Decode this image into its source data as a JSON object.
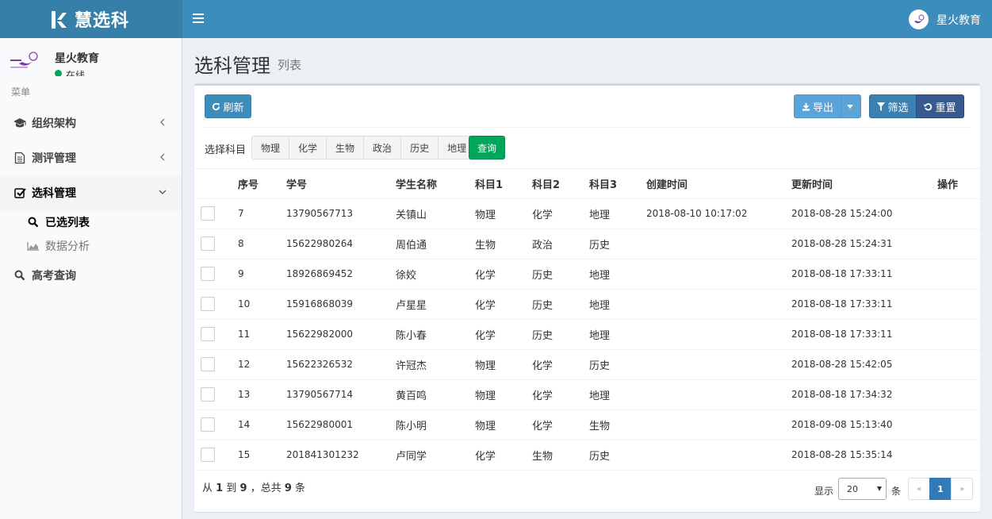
{
  "header": {
    "app_name": "慧选科",
    "user_name": "星火教育"
  },
  "sidebar": {
    "user": {
      "name": "星火教育",
      "status": "在线"
    },
    "menu_header": "菜单",
    "items": [
      {
        "label": "组织架构",
        "icon": "graduation-cap-icon"
      },
      {
        "label": "测评管理",
        "icon": "file-text-icon"
      },
      {
        "label": "选科管理",
        "icon": "check-square-icon"
      },
      {
        "label": "高考查询",
        "icon": "search-icon"
      }
    ],
    "sub_items": [
      {
        "label": "已选列表",
        "icon": "search-icon"
      },
      {
        "label": "数据分析",
        "icon": "area-chart-icon"
      }
    ]
  },
  "page": {
    "title": "选科管理",
    "subtitle": "列表"
  },
  "toolbar": {
    "refresh_label": "刷新",
    "export_label": "导出",
    "filter_label": "筛选",
    "reset_label": "重置"
  },
  "subject_filter": {
    "label": "选择科目",
    "subjects": [
      "物理",
      "化学",
      "生物",
      "政治",
      "历史",
      "地理"
    ],
    "query_label": "查询"
  },
  "table": {
    "columns": [
      "序号",
      "学号",
      "学生名称",
      "科目1",
      "科目2",
      "科目3",
      "创建时间",
      "更新时间",
      "操作"
    ],
    "rows": [
      {
        "seq": "7",
        "student_id": "13790567713",
        "name": "关镇山",
        "s1": "物理",
        "s2": "化学",
        "s3": "地理",
        "created": "2018-08-10 10:17:02",
        "updated": "2018-08-28 15:24:00"
      },
      {
        "seq": "8",
        "student_id": "15622980264",
        "name": "周伯通",
        "s1": "生物",
        "s2": "政治",
        "s3": "历史",
        "created": "",
        "updated": "2018-08-28 15:24:31"
      },
      {
        "seq": "9",
        "student_id": "18926869452",
        "name": "徐姣",
        "s1": "化学",
        "s2": "历史",
        "s3": "地理",
        "created": "",
        "updated": "2018-08-18 17:33:11"
      },
      {
        "seq": "10",
        "student_id": "15916868039",
        "name": "卢星星",
        "s1": "化学",
        "s2": "历史",
        "s3": "地理",
        "created": "",
        "updated": "2018-08-18 17:33:11"
      },
      {
        "seq": "11",
        "student_id": "15622982000",
        "name": "陈小春",
        "s1": "化学",
        "s2": "历史",
        "s3": "地理",
        "created": "",
        "updated": "2018-08-18 17:33:11"
      },
      {
        "seq": "12",
        "student_id": "15622326532",
        "name": "许冠杰",
        "s1": "物理",
        "s2": "化学",
        "s3": "历史",
        "created": "",
        "updated": "2018-08-28 15:42:05"
      },
      {
        "seq": "13",
        "student_id": "13790567714",
        "name": "黄百鸣",
        "s1": "物理",
        "s2": "化学",
        "s3": "地理",
        "created": "",
        "updated": "2018-08-18 17:34:32"
      },
      {
        "seq": "14",
        "student_id": "15622980001",
        "name": "陈小明",
        "s1": "物理",
        "s2": "化学",
        "s3": "生物",
        "created": "",
        "updated": "2018-09-08 15:13:40"
      },
      {
        "seq": "15",
        "student_id": "201841301232",
        "name": "卢同学",
        "s1": "化学",
        "s2": "生物",
        "s3": "历史",
        "created": "",
        "updated": "2018-08-28 15:35:14"
      }
    ]
  },
  "footer": {
    "info_prefix": "从",
    "from": "1",
    "info_to": "到",
    "to": "9",
    "info_total": "，总共",
    "total": "9",
    "info_suffix": "条",
    "show_label": "显示",
    "page_size": "20",
    "items_label": "条",
    "prev": "«",
    "current_page": "1",
    "next": "»"
  },
  "colors": {
    "header": "#3c8dbc",
    "logo_bg": "#367fa9",
    "primary": "#3c8dbc",
    "success": "#00a65a",
    "online": "#00a65a"
  }
}
